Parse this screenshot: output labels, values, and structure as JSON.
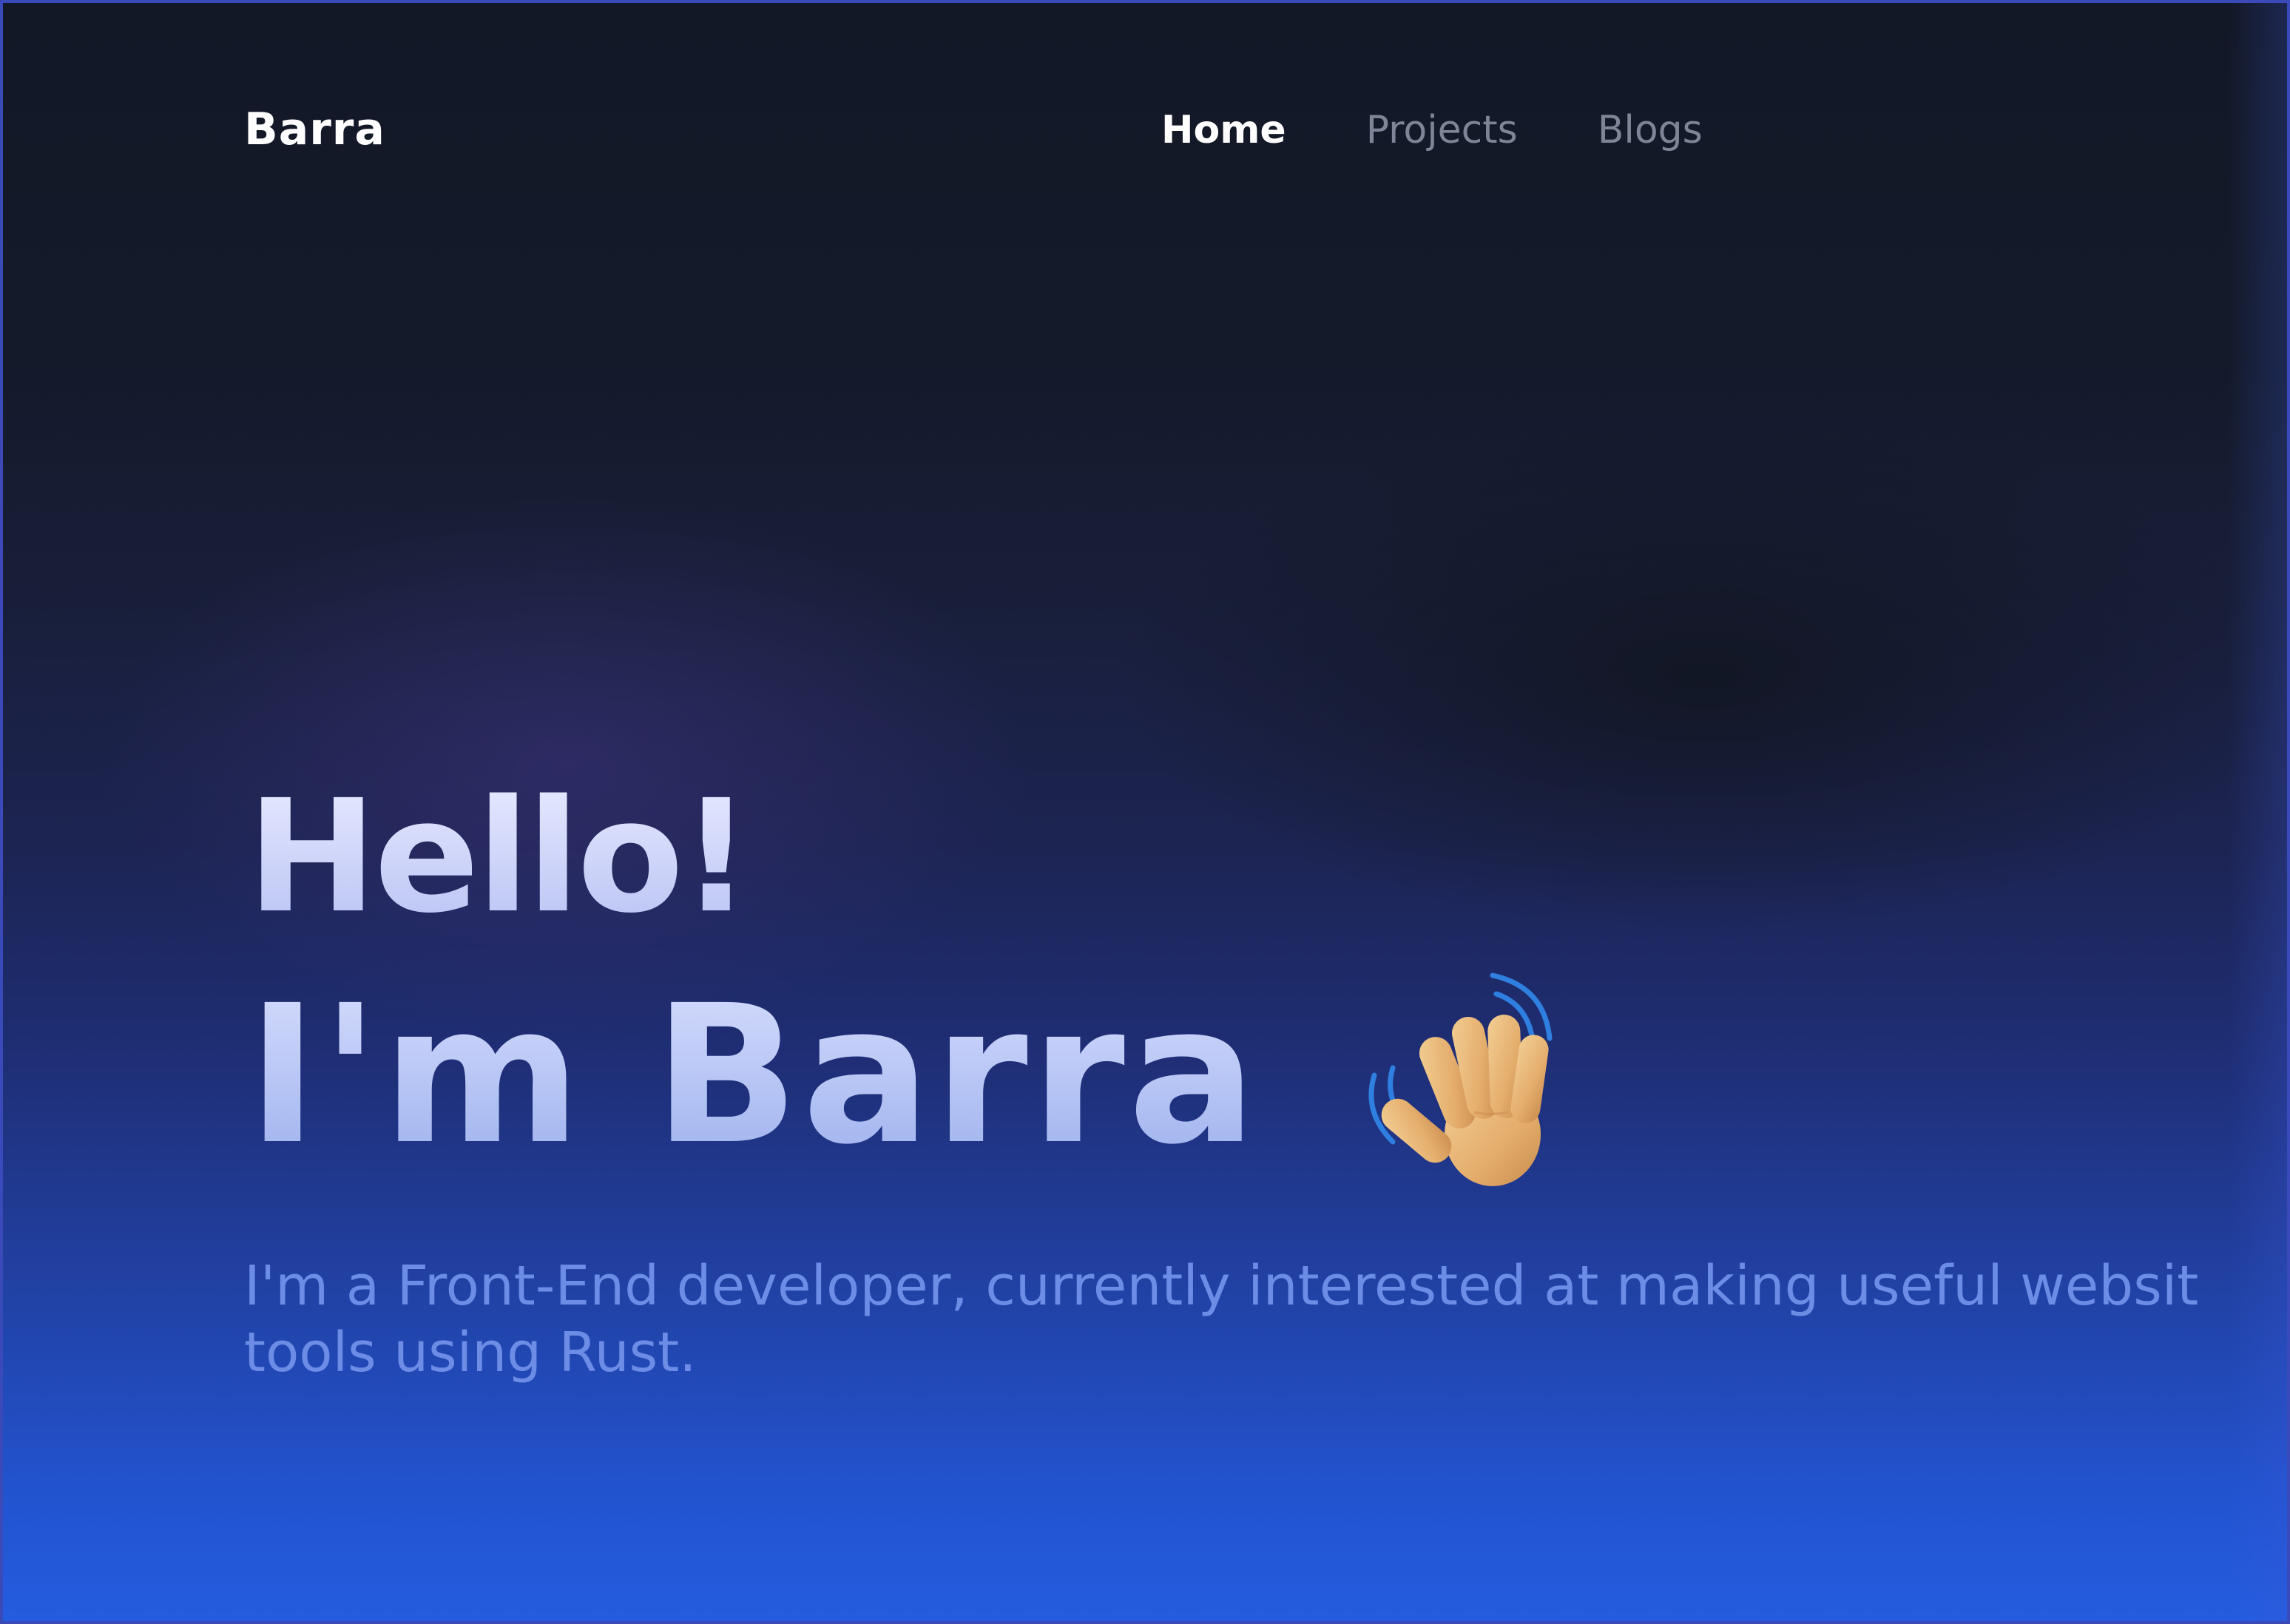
{
  "brand": {
    "name": "Barra"
  },
  "nav": {
    "items": [
      {
        "label": "Home",
        "active": true
      },
      {
        "label": "Projects",
        "active": false
      },
      {
        "label": "Blogs",
        "active": false
      }
    ]
  },
  "hero": {
    "greeting": "Hello!",
    "name": "I'm Barra",
    "icon": "waving-hand-icon",
    "description_line1": "I'm a Front-End developer, currently interested at making useful websit",
    "description_line2": "tools using Rust."
  },
  "colors": {
    "background_top": "#131826",
    "background_bottom": "#245cdf",
    "nav_active": "#ffffff",
    "nav_inactive": "#7d8597",
    "description": "#6c8ce6"
  }
}
